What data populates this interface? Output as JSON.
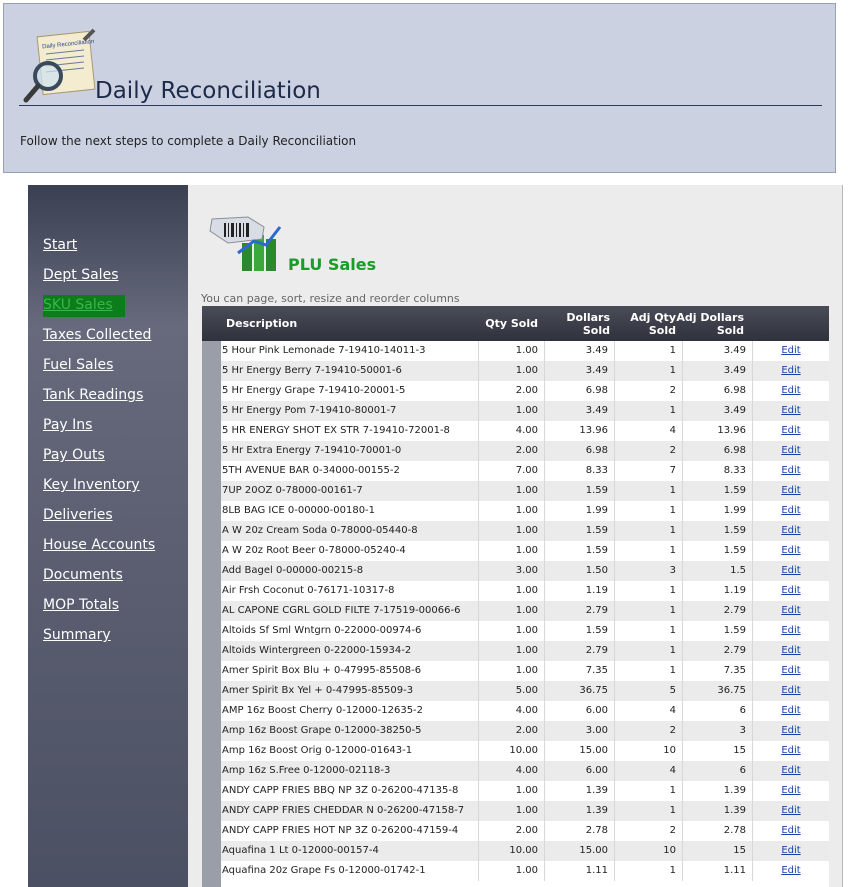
{
  "header": {
    "title": "Daily Reconciliation",
    "subtitle": "Follow the next steps to complete a Daily Reconciliation",
    "logo_caption": "Daily Reconciliation"
  },
  "sidebar": {
    "items": [
      {
        "label": "Start"
      },
      {
        "label": "Dept Sales"
      },
      {
        "label": "SKU Sales",
        "active": true
      },
      {
        "label": "Taxes Collected"
      },
      {
        "label": "Fuel Sales"
      },
      {
        "label": "Tank Readings"
      },
      {
        "label": "Pay Ins"
      },
      {
        "label": "Pay Outs"
      },
      {
        "label": "Key Inventory"
      },
      {
        "label": "Deliveries"
      },
      {
        "label": "House Accounts"
      },
      {
        "label": "Documents"
      },
      {
        "label": "MOP Totals"
      },
      {
        "label": "Summary"
      }
    ],
    "active_color": "#0c7d1a"
  },
  "panel": {
    "title": "PLU Sales",
    "hint": "You can page, sort, resize and reorder columns"
  },
  "grid": {
    "columns": {
      "description": "Description",
      "qty_sold": "Qty Sold",
      "dollars_sold": "Dollars Sold",
      "adj_qty_sold": "Adj Qty Sold",
      "adj_dollars_sold": "Adj Dollars Sold"
    },
    "edit_label": "Edit",
    "rows": [
      [
        "5 Hour Pink Lemonade 7-19410-14011-3",
        "1.00",
        "3.49",
        "1",
        "3.49"
      ],
      [
        "5 Hr Energy Berry 7-19410-50001-6",
        "1.00",
        "3.49",
        "1",
        "3.49"
      ],
      [
        "5 Hr Energy Grape 7-19410-20001-5",
        "2.00",
        "6.98",
        "2",
        "6.98"
      ],
      [
        "5 Hr Energy Pom 7-19410-80001-7",
        "1.00",
        "3.49",
        "1",
        "3.49"
      ],
      [
        "5 HR ENERGY SHOT EX STR 7-19410-72001-8",
        "4.00",
        "13.96",
        "4",
        "13.96"
      ],
      [
        "5 Hr Extra Energy 7-19410-70001-0",
        "2.00",
        "6.98",
        "2",
        "6.98"
      ],
      [
        "5TH AVENUE BAR 0-34000-00155-2",
        "7.00",
        "8.33",
        "7",
        "8.33"
      ],
      [
        "7UP 20OZ 0-78000-00161-7",
        "1.00",
        "1.59",
        "1",
        "1.59"
      ],
      [
        "8LB BAG ICE 0-00000-00180-1",
        "1.00",
        "1.99",
        "1",
        "1.99"
      ],
      [
        "A W 20z Cream Soda 0-78000-05440-8",
        "1.00",
        "1.59",
        "1",
        "1.59"
      ],
      [
        "A W 20z Root Beer 0-78000-05240-4",
        "1.00",
        "1.59",
        "1",
        "1.59"
      ],
      [
        "Add Bagel 0-00000-00215-8",
        "3.00",
        "1.50",
        "3",
        "1.5"
      ],
      [
        "Air Frsh Coconut 0-76171-10317-8",
        "1.00",
        "1.19",
        "1",
        "1.19"
      ],
      [
        "AL CAPONE CGRL GOLD FILTE 7-17519-00066-6",
        "1.00",
        "2.79",
        "1",
        "2.79"
      ],
      [
        "Altoids Sf Sml Wntgrn 0-22000-00974-6",
        "1.00",
        "1.59",
        "1",
        "1.59"
      ],
      [
        "Altoids Wintergreen 0-22000-15934-2",
        "1.00",
        "2.79",
        "1",
        "2.79"
      ],
      [
        "Amer Spirit Box Blu + 0-47995-85508-6",
        "1.00",
        "7.35",
        "1",
        "7.35"
      ],
      [
        "Amer Spirit Bx Yel + 0-47995-85509-3",
        "5.00",
        "36.75",
        "5",
        "36.75"
      ],
      [
        "AMP 16z Boost Cherry 0-12000-12635-2",
        "4.00",
        "6.00",
        "4",
        "6"
      ],
      [
        "Amp 16z Boost Grape 0-12000-38250-5",
        "2.00",
        "3.00",
        "2",
        "3"
      ],
      [
        "Amp 16z Boost Orig 0-12000-01643-1",
        "10.00",
        "15.00",
        "10",
        "15"
      ],
      [
        "Amp 16z S.Free 0-12000-02118-3",
        "4.00",
        "6.00",
        "4",
        "6"
      ],
      [
        "ANDY CAPP FRIES BBQ NP 3Z 0-26200-47135-8",
        "1.00",
        "1.39",
        "1",
        "1.39"
      ],
      [
        "ANDY CAPP FRIES CHEDDAR N 0-26200-47158-7",
        "1.00",
        "1.39",
        "1",
        "1.39"
      ],
      [
        "ANDY CAPP FRIES HOT NP 3Z 0-26200-47159-4",
        "2.00",
        "2.78",
        "2",
        "2.78"
      ],
      [
        "Aquafina 1 Lt 0-12000-00157-4",
        "10.00",
        "15.00",
        "10",
        "15"
      ],
      [
        "Aquafina 20z Grape Fs 0-12000-01742-1",
        "1.00",
        "1.11",
        "1",
        "1.11"
      ]
    ]
  }
}
